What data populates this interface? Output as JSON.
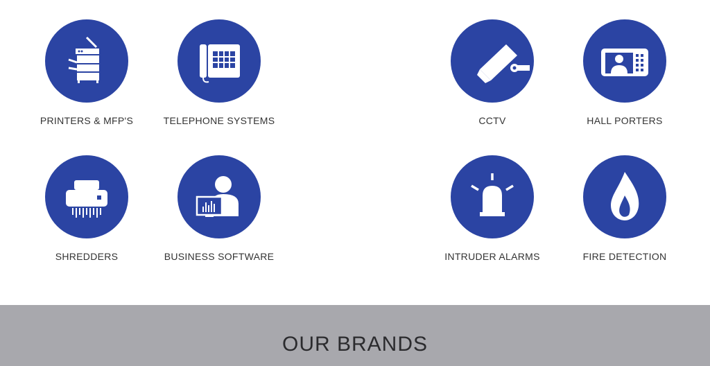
{
  "services": [
    {
      "label": "PRINTERS & MFP'S",
      "icon": "printer-icon"
    },
    {
      "label": "TELEPHONE SYSTEMS",
      "icon": "telephone-icon"
    },
    {
      "label": "CCTV",
      "icon": "cctv-camera-icon"
    },
    {
      "label": "HALL PORTERS",
      "icon": "door-entry-icon"
    },
    {
      "label": "SHREDDERS",
      "icon": "shredder-icon"
    },
    {
      "label": "BUSINESS SOFTWARE",
      "icon": "business-software-icon"
    },
    {
      "label": "INTRUDER ALARMS",
      "icon": "alarm-siren-icon"
    },
    {
      "label": "FIRE DETECTION",
      "icon": "flame-icon"
    }
  ],
  "brands": {
    "title": "OUR BRANDS"
  },
  "colors": {
    "accent": "#2b44a3",
    "brands_bg": "#a8a8ad",
    "text": "#333333"
  }
}
